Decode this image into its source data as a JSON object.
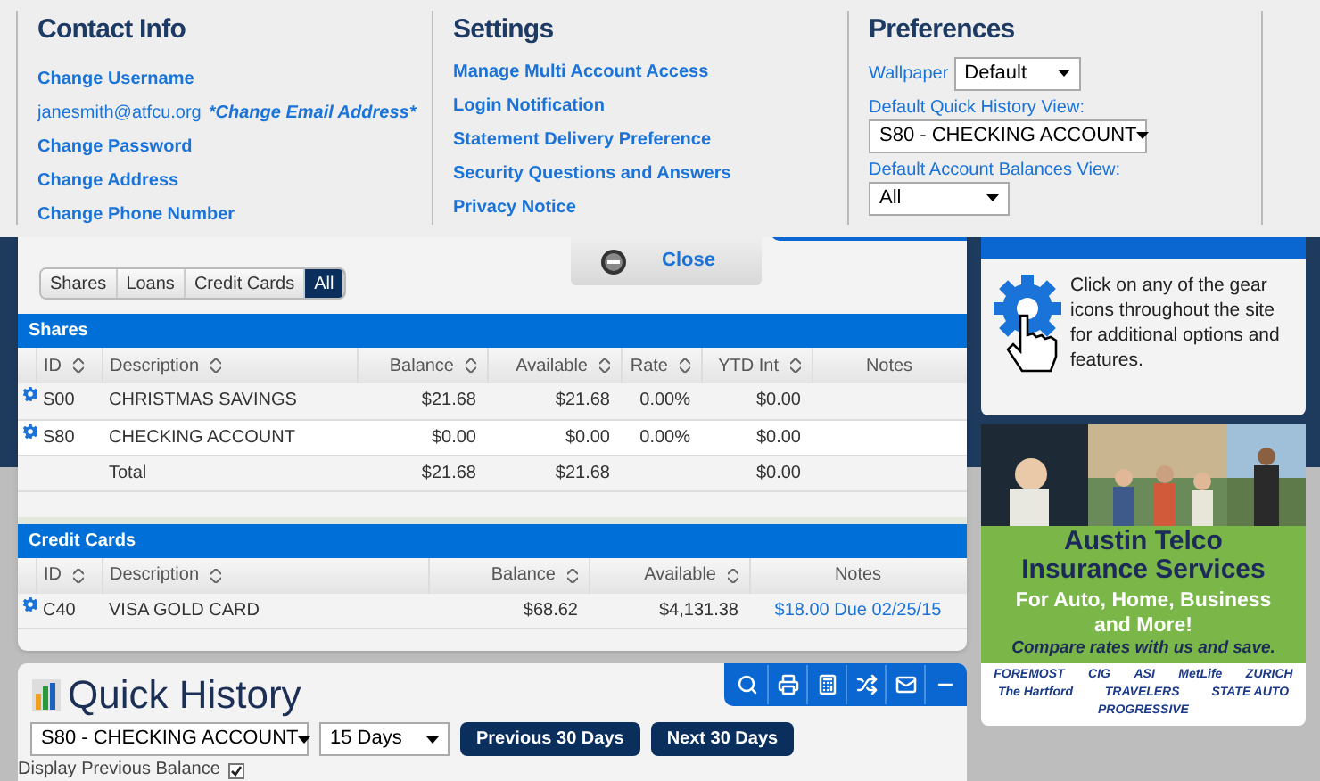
{
  "menu": {
    "contact_info": {
      "title": "Contact Info",
      "items": [
        {
          "kind": "link",
          "text": "Change Username"
        },
        {
          "kind": "email",
          "text": "janesmith@atfcu.org",
          "link": "*Change Email Address*"
        },
        {
          "kind": "link",
          "text": "Change Password"
        },
        {
          "kind": "link",
          "text": "Change Address"
        },
        {
          "kind": "link",
          "text": "Change Phone Number"
        }
      ]
    },
    "settings": {
      "title": "Settings",
      "links": [
        "Manage Multi Account Access",
        "Login Notification",
        "Statement Delivery Preference",
        "Security Questions and Answers",
        "Privacy Notice"
      ]
    },
    "preferences": {
      "title": "Preferences",
      "wallpaper": {
        "label": "Wallpaper",
        "value": "Default"
      },
      "quick_history_view": {
        "label": "Default Quick History View:",
        "value": "S80 - CHECKING ACCOUNT"
      },
      "balances_view": {
        "label": "Default Account Balances View:",
        "value": "All"
      }
    },
    "close_button": "Close"
  },
  "account_balances": {
    "filter_tabs": [
      {
        "label": "Shares",
        "selected": false
      },
      {
        "label": "Loans",
        "selected": false
      },
      {
        "label": "Credit Cards",
        "selected": false
      },
      {
        "label": "All",
        "selected": true
      }
    ],
    "sections": [
      {
        "title": "Shares",
        "columns": [
          {
            "label": "ID",
            "sortable": true
          },
          {
            "label": "Description",
            "sortable": true
          },
          {
            "label": "Balance",
            "sortable": true
          },
          {
            "label": "Available",
            "sortable": true
          },
          {
            "label": "Rate",
            "sortable": true
          },
          {
            "label": "YTD Int",
            "sortable": true
          },
          {
            "label": "Notes",
            "sortable": false
          }
        ],
        "rows": [
          {
            "kind": "account",
            "cells": [
              "S00",
              "CHRISTMAS SAVINGS",
              "$21.68",
              "$21.68",
              "0.00%",
              "$0.00",
              null
            ]
          },
          {
            "kind": "account",
            "cells": [
              "S80",
              "CHECKING ACCOUNT",
              "$0.00",
              "$0.00",
              "0.00%",
              "$0.00",
              null
            ]
          },
          {
            "kind": "total",
            "cells": [
              null,
              "Total",
              "$21.68",
              "$21.68",
              null,
              "$0.00",
              null
            ]
          }
        ]
      },
      {
        "title": "Credit Cards",
        "columns": [
          {
            "label": "ID",
            "sortable": true
          },
          {
            "label": "Description",
            "sortable": true
          },
          {
            "label": "Balance",
            "sortable": true
          },
          {
            "label": "Available",
            "sortable": true
          },
          {
            "label": "Notes",
            "sortable": false
          }
        ],
        "rows": [
          {
            "kind": "account",
            "cells": [
              "C40",
              "VISA GOLD CARD",
              "$68.62",
              "$4,131.38",
              "$18.00 Due 02/25/15"
            ]
          }
        ]
      }
    ]
  },
  "quick_history": {
    "title": "Quick History",
    "account": "S80 - CHECKING ACCOUNT",
    "period": "15 Days",
    "buttons": [
      "Previous 30 Days",
      "Next 30 Days"
    ],
    "display_previous_balance": {
      "label": "Display Previous Balance",
      "checked": true
    }
  },
  "sidebar": {
    "gears": {
      "text": "Click on any of the gear icons throughout the site for additional options and features."
    },
    "ad": {
      "kind": "picture",
      "headline": "Austin Telco Insurance Services",
      "offer": "For Auto, Home, Business and More!",
      "slogan": "Compare rates with us and save.",
      "logos": [
        "FOREMOST",
        "CIG",
        "ASI",
        "MetLife",
        "ZURICH",
        "The Hartford",
        "TRAVELERS",
        "STATE AUTO",
        "PROGRESSIVE"
      ]
    }
  }
}
